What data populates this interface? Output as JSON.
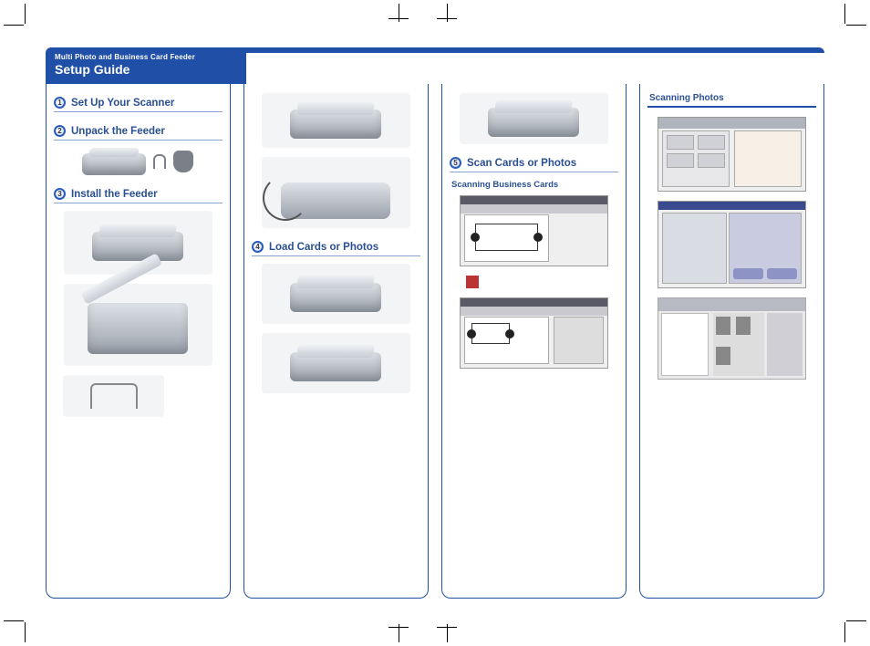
{
  "header": {
    "pretitle": "Multi Photo and Business Card Feeder",
    "title": "Setup Guide"
  },
  "steps": {
    "s1": {
      "num": "1",
      "label": "Set Up Your Scanner"
    },
    "s2": {
      "num": "2",
      "label": "Unpack the Feeder"
    },
    "s3": {
      "num": "3",
      "label": "Install the Feeder"
    },
    "s4": {
      "num": "4",
      "label": "Load Cards or Photos"
    },
    "s5": {
      "num": "5",
      "label": "Scan Cards or Photos"
    }
  },
  "subs": {
    "biz": "Scanning Business Cards",
    "photos": "Scanning Photos"
  }
}
